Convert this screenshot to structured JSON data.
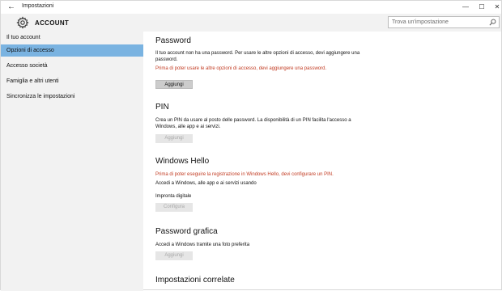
{
  "window": {
    "title": "Impostazioni",
    "back_glyph": "←",
    "minimize_glyph": "—",
    "maximize_glyph": "☐",
    "close_glyph": "✕"
  },
  "header": {
    "title": "ACCOUNT",
    "icon": "gear-icon",
    "search_placeholder": "Trova un'impostazione"
  },
  "sidebar": {
    "items": [
      {
        "label": "Il tuo account"
      },
      {
        "label": "Opzioni di accesso",
        "selected": true
      },
      {
        "label": "Accesso società"
      },
      {
        "label": "Famiglia e altri utenti"
      },
      {
        "label": "Sincronizza le impostazioni"
      }
    ]
  },
  "main": {
    "password": {
      "title": "Password",
      "desc": "Il tuo account non ha una password. Per usare le altre opzioni di accesso, devi aggiungere una password.",
      "warning": "Prima di poter usare le altre opzioni di accesso, devi aggiungere una password.",
      "button": "Aggiungi"
    },
    "pin": {
      "title": "PIN",
      "desc": "Crea un PIN da usare al posto delle password. La disponibilità di un PIN facilita l'accesso a Windows, alle app e ai servizi.",
      "button": "Aggiungi"
    },
    "hello": {
      "title": "Windows Hello",
      "warning": "Prima di poter eseguire la registrazione in Windows Hello, devi configurare un PIN.",
      "desc": "Accedi a Windows, alle app e ai servizi usando",
      "fingerprint_label": "Impronta digitale",
      "button": "Configura"
    },
    "picture": {
      "title": "Password grafica",
      "desc": "Accedi a Windows tramite una foto preferita",
      "button": "Aggiungi"
    },
    "related": {
      "title": "Impostazioni correlate"
    }
  },
  "colors": {
    "accent_selected": "#7ab3e1",
    "warning_text": "#c23b22",
    "sidebar_bg": "#f2f2f2"
  }
}
